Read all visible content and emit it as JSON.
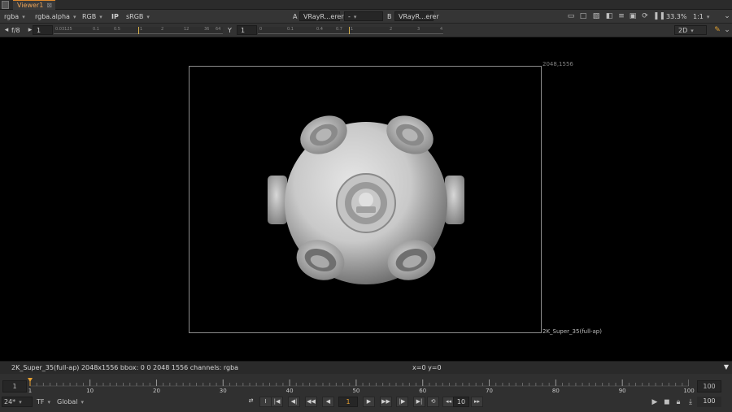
{
  "tab": {
    "label": "Viewer1",
    "close": "⊠"
  },
  "toolbar": {
    "channels": "rgba",
    "alpha": "rgba.alpha",
    "colorspace_mode": "RGB",
    "ip": "IP",
    "display_lut": "sRGB",
    "input_a_label": "A",
    "input_a": "VRayR...erer",
    "compare": "-",
    "input_b_label": "B",
    "input_b": "VRayR...erer",
    "zoom": "33.3%",
    "proxy": "1:1"
  },
  "gain_bar": {
    "fstop": "f/8",
    "gain_value": "1",
    "gain_ticks": [
      "0.03125",
      "0.1",
      "0.5",
      "1",
      "2",
      "12",
      "36",
      "64"
    ],
    "gamma_label": "Y",
    "gamma_value": "1",
    "gamma_ticks": [
      "0",
      "0.1",
      "0.4",
      "0.7",
      "1",
      "2",
      "3",
      "4"
    ],
    "view_mode": "2D"
  },
  "viewer": {
    "format_size": "2048,1556",
    "format_name": "2K_Super_35(full-ap)"
  },
  "info": {
    "text": "2K_Super_35(full-ap) 2048x1556  bbox: 0 0 2048 1556 channels: rgba",
    "coords": "x=0 y=0"
  },
  "timeline": {
    "in_frame": "1",
    "out_frame": "100",
    "ruler_labels": [
      "1",
      "10",
      "20",
      "30",
      "40",
      "50",
      "60",
      "70",
      "80",
      "90",
      "100"
    ],
    "fps": "24*",
    "tf": "TF",
    "range_mode": "Global",
    "current_frame": "1",
    "increment": "10",
    "end_frame": "100",
    "playhead_frame": 1,
    "first_frame": 1,
    "last_frame": 100
  },
  "colors": {
    "accent": "#e08a2c",
    "playhead": "#e8a030"
  }
}
